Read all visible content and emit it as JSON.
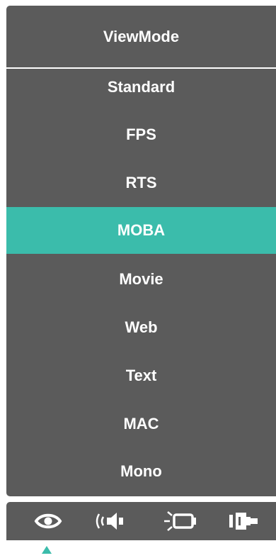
{
  "menu": {
    "title": "ViewMode",
    "items": [
      {
        "label": "Standard"
      },
      {
        "label": "FPS"
      },
      {
        "label": "RTS"
      },
      {
        "label": "MOBA",
        "selected": true
      },
      {
        "label": "Movie"
      },
      {
        "label": "Web"
      },
      {
        "label": "Text"
      },
      {
        "label": "MAC"
      },
      {
        "label": "Mono"
      }
    ]
  },
  "icon_bar": {
    "icons": [
      "eye-icon",
      "audio-speaker-icon",
      "display-settings-icon",
      "input-connector-icon"
    ],
    "active_index": 0
  },
  "colors": {
    "panel": "#5b5b5b",
    "accent": "#3bbcab",
    "text": "#ffffff"
  }
}
